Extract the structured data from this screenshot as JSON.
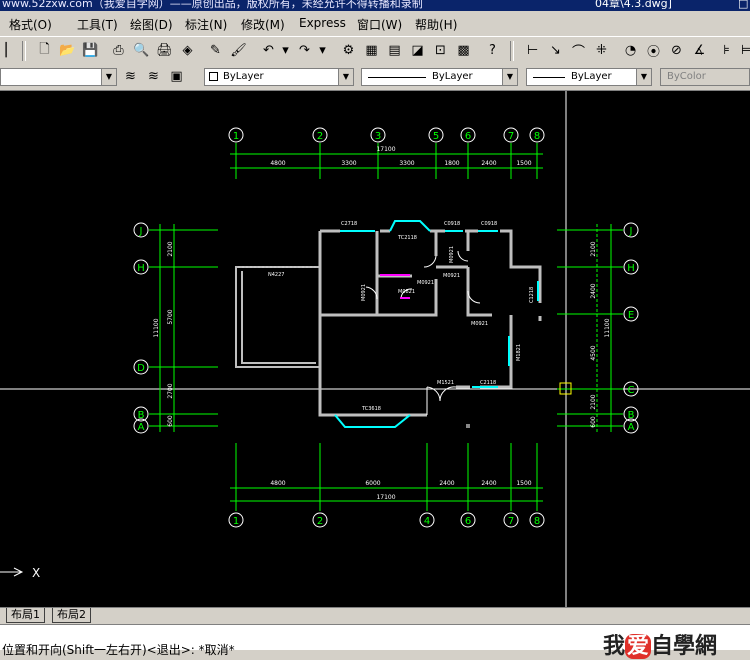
{
  "window": {
    "title_left": "www.52zxw.com（我爱自学网）——原创出品，版权所有，未经允许不得转播和录制",
    "title_file": "04章\\4.3.dwg]",
    "title_right": "□"
  },
  "menubar": {
    "items": [
      "格式(O)",
      "工具(T)",
      "绘图(D)",
      "标注(N)",
      "修改(M)",
      "Express",
      "窗口(W)",
      "帮助(H)"
    ]
  },
  "properties": {
    "color": "ByLayer",
    "linetype": "ByLayer",
    "lineweight": "ByLayer",
    "plotstyle": "ByColor"
  },
  "drawing": {
    "top_axes": [
      "1",
      "2",
      "3",
      "5",
      "6",
      "7",
      "8"
    ],
    "bottom_axes": [
      "1",
      "2",
      "4",
      "6",
      "7",
      "8"
    ],
    "left_axes": [
      "J",
      "H",
      "D",
      "B",
      "A"
    ],
    "right_axes": [
      "J",
      "H",
      "E",
      "C",
      "B",
      "A"
    ],
    "top_total": "17100",
    "top_dims": [
      "4800",
      "3300",
      "3300",
      "1800",
      "2400",
      "1500"
    ],
    "bottom_total": "17100",
    "bottom_dims": [
      "4800",
      "6000",
      "2400",
      "2400",
      "1500"
    ],
    "left_total": "11100",
    "left_dims": [
      "2100",
      "5700",
      "2700",
      "600"
    ],
    "right_total": "11100",
    "right_dims": [
      "2100",
      "2400",
      "4500",
      "2100",
      "600"
    ],
    "labels": {
      "c2718": "C2718",
      "tc2118": "TC2118",
      "c0918": "C0918",
      "c0918b": "C0918",
      "n4227": "N4227",
      "m0921a": "M0921",
      "m0921b": "M0921",
      "m0921c": "M0921",
      "m0921d": "M0921",
      "m0921e": "M0921",
      "m0821": "M0821",
      "c1218": "C1218",
      "m1821": "M1821",
      "m1521": "M1521",
      "c2118": "C2118",
      "tc3618": "TC3618"
    },
    "ucs_x": "X"
  },
  "tabs": [
    "布局1",
    "布局2"
  ],
  "command": {
    "text": "位置和开向(Shift一左右开)<退出>: *取消*"
  },
  "logo": {
    "p1": "我",
    "p2": "爱",
    "p3": "自學網"
  }
}
